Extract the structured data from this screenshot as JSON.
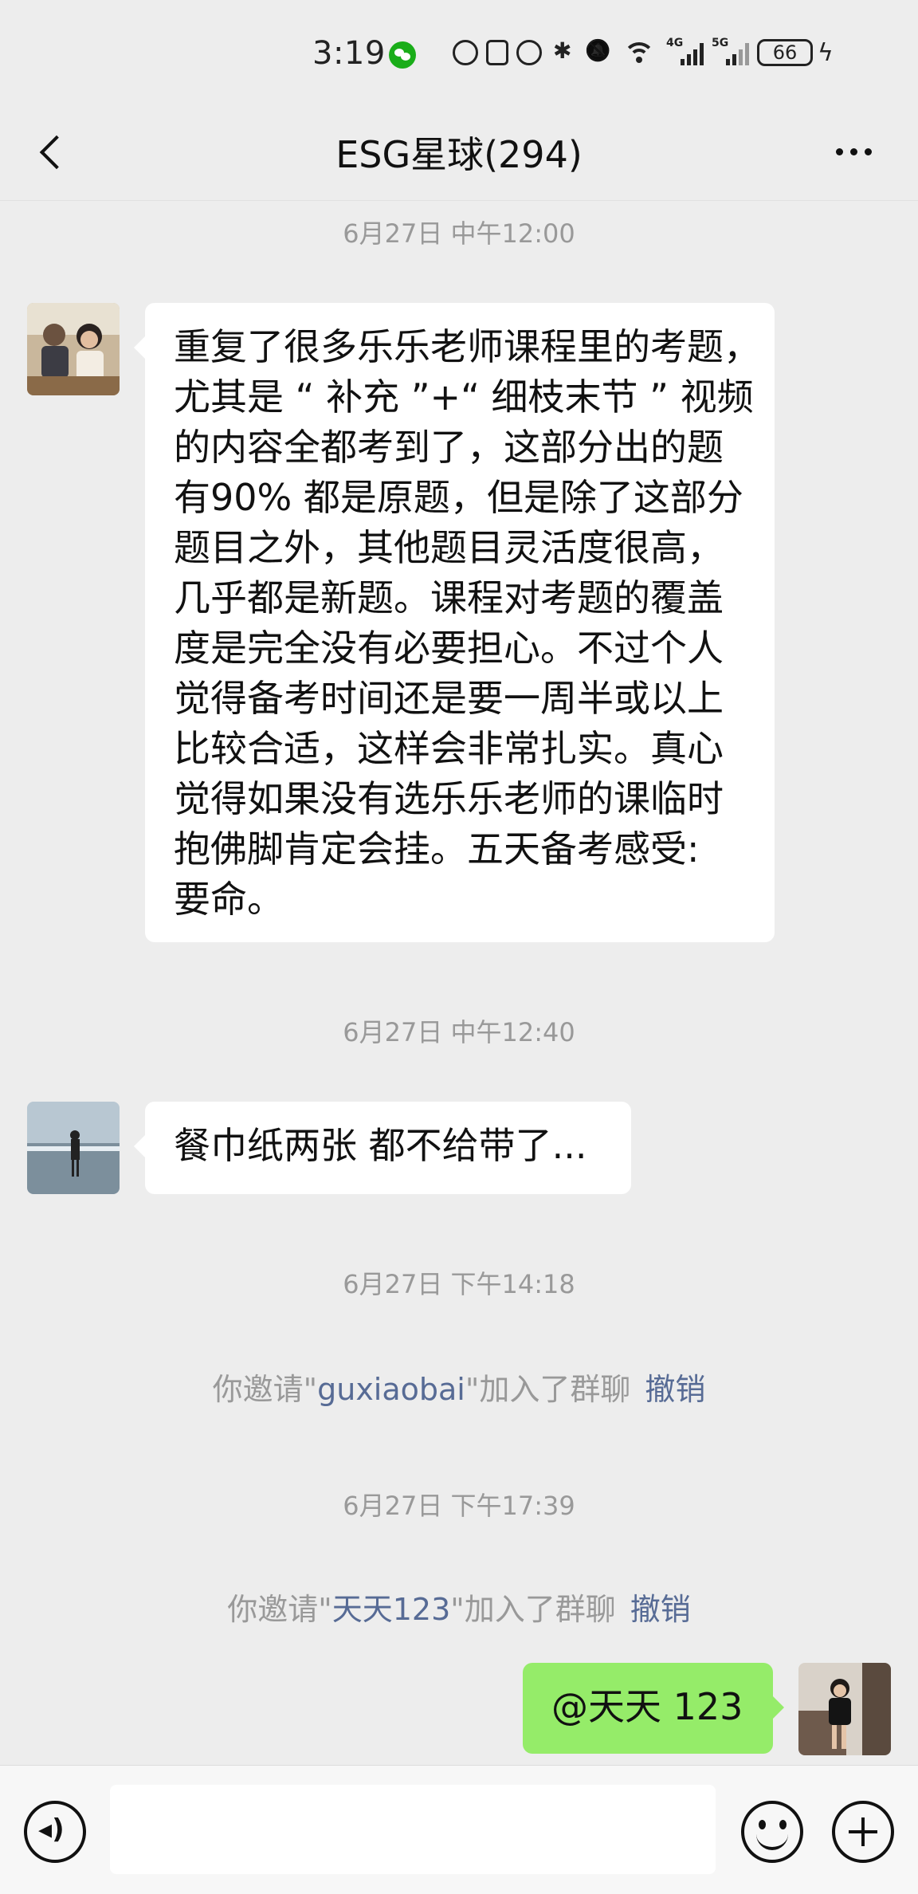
{
  "status_bar": {
    "time": "3:19",
    "battery": "66",
    "net_4g": "4G",
    "net_5g": "5G",
    "icons": [
      "wechat-notification-icon",
      "nfc-icon",
      "alarm-icon",
      "bluetooth-icon",
      "vibrate-icon",
      "mute-icon",
      "wifi-icon",
      "signal-icon",
      "battery-icon",
      "charging-icon"
    ]
  },
  "header": {
    "title": "ESG星球(294)"
  },
  "messages": {
    "ts1": "6月27日 中午12:00",
    "msg1_lines": [
      "重复了很多乐乐老师课程里的考题，",
      "尤其是 “ 补充 ”+“ 细枝末节 ” 视频",
      "的内容全都考到了，这部分出的题",
      "有90% 都是原题，但是除了这部分",
      "题目之外，其他题目灵活度很高，",
      "几乎都是新题。课程对考题的覆盖",
      "度是完全没有必要担心。不过个人",
      "觉得备考时间还是要一周半或以上",
      "比较合适，这样会非常扎实。真心",
      "觉得如果没有选乐乐老师的课临时",
      "抱佛脚肯定会挂。五天备考感受:",
      "要命。"
    ],
    "ts2": "6月27日 中午12:40",
    "msg2": "餐巾纸两张 都不给带了...",
    "ts3": "6月27日 下午14:18",
    "sys1": {
      "prefix": "你邀请\"",
      "nick": "guxiaobai",
      "suffix": "\"加入了群聊",
      "undo": "撤销"
    },
    "ts4": "6月27日 下午17:39",
    "sys2": {
      "prefix": "你邀请\"",
      "nick": "天天123",
      "suffix": "\"加入了群聊",
      "undo": "撤销"
    },
    "msg3": "@天天 123"
  },
  "input_bar": {
    "placeholder": ""
  },
  "colors": {
    "background": "#ededed",
    "bubble_left": "#ffffff",
    "bubble_right": "#95ec69",
    "link": "#576b95",
    "timestamp": "#999999"
  }
}
